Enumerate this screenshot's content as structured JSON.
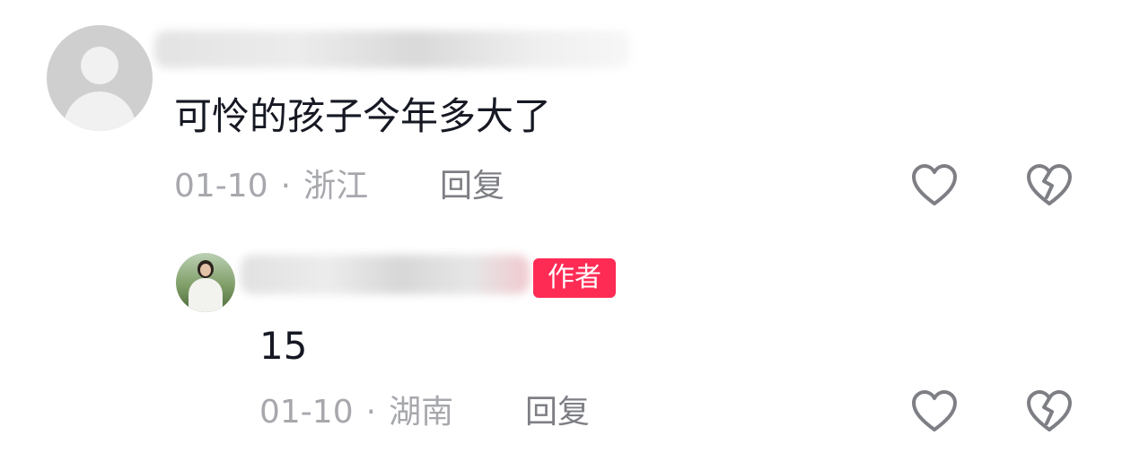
{
  "comments": [
    {
      "text": "可怜的孩子今年多大了",
      "date": "01-10",
      "location": "浙江",
      "reply_label": "回复"
    },
    {
      "badge": "作者",
      "text": "15",
      "date": "01-10",
      "location": "湖南",
      "reply_label": "回复"
    }
  ],
  "separator": "·",
  "icons": {
    "like": "heart-outline-icon",
    "dislike": "broken-heart-icon"
  },
  "colors": {
    "badge_bg": "#fe2c55",
    "text": "#161823",
    "meta": "#a7a8ad"
  }
}
